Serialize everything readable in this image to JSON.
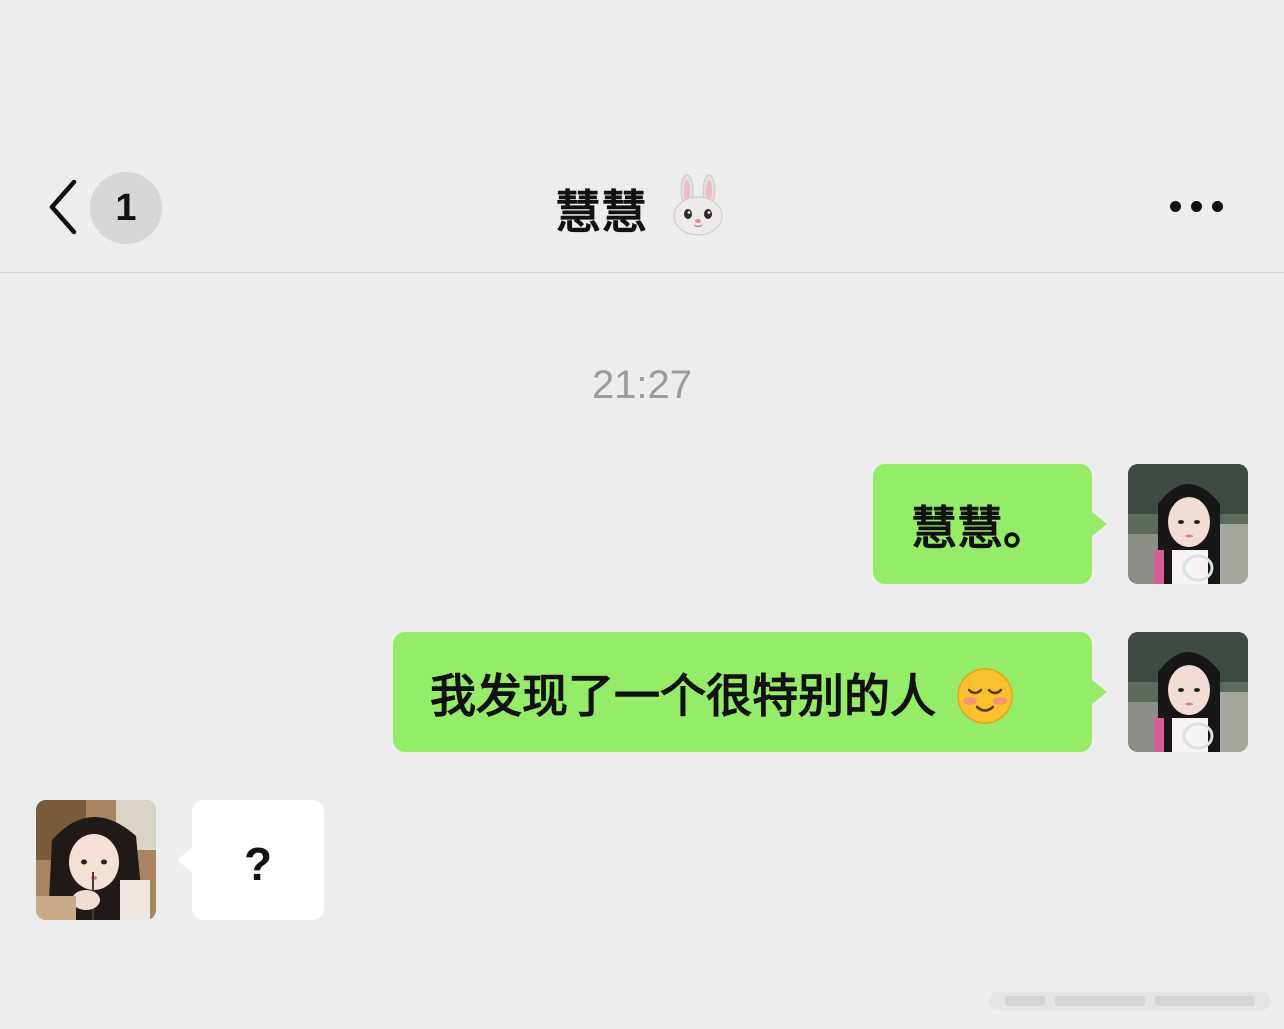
{
  "header": {
    "back_icon": "chevron-left-icon",
    "unread_count": "1",
    "title": "慧慧",
    "title_emoji": "rabbit-face-icon",
    "more_icon": "more-dots-icon"
  },
  "chat": {
    "timestamp": "21:27",
    "messages": [
      {
        "direction": "sent",
        "text": "慧慧。"
      },
      {
        "direction": "sent",
        "text": "我发现了一个很特别的人",
        "emoji": "blushing-smile-icon"
      },
      {
        "direction": "received",
        "text": "?"
      }
    ]
  },
  "colors": {
    "background": "#ededed",
    "sent_bubble": "#95ec69",
    "received_bubble": "#ffffff",
    "badge": "#d6d6d6",
    "timestamp": "#9b9b9b"
  }
}
